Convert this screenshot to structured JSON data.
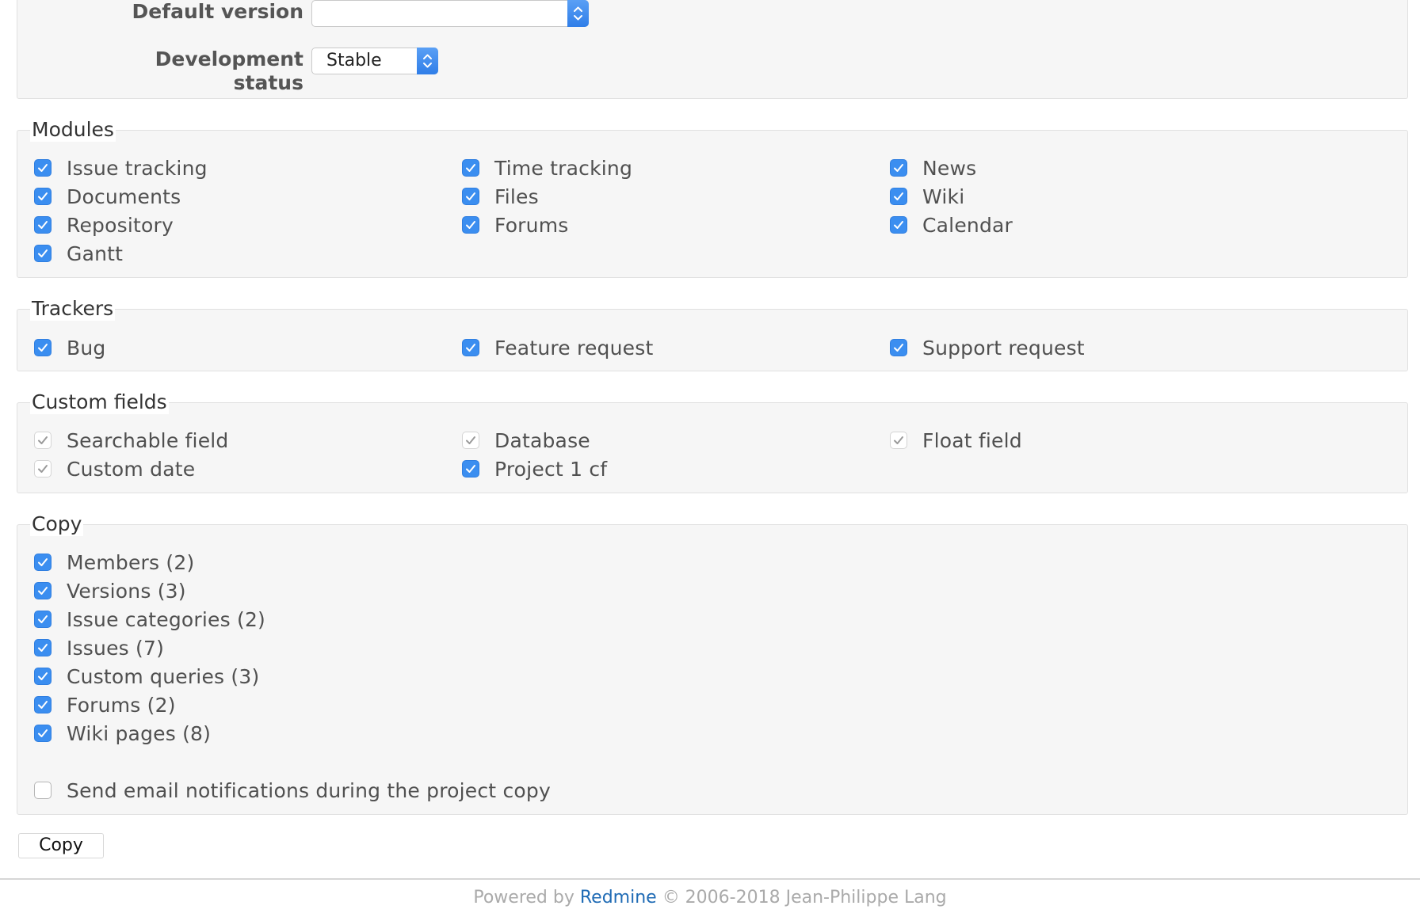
{
  "form": {
    "default_version": {
      "label": "Default version",
      "value": ""
    },
    "development_status": {
      "label": "Development status",
      "value": "Stable"
    }
  },
  "modules": {
    "legend": "Modules",
    "items": [
      {
        "label": "Issue tracking",
        "checked": true
      },
      {
        "label": "Time tracking",
        "checked": true
      },
      {
        "label": "News",
        "checked": true
      },
      {
        "label": "Documents",
        "checked": true
      },
      {
        "label": "Files",
        "checked": true
      },
      {
        "label": "Wiki",
        "checked": true
      },
      {
        "label": "Repository",
        "checked": true
      },
      {
        "label": "Forums",
        "checked": true
      },
      {
        "label": "Calendar",
        "checked": true
      },
      {
        "label": "Gantt",
        "checked": true
      }
    ]
  },
  "trackers": {
    "legend": "Trackers",
    "items": [
      {
        "label": "Bug",
        "checked": true
      },
      {
        "label": "Feature request",
        "checked": true
      },
      {
        "label": "Support request",
        "checked": true
      }
    ]
  },
  "custom_fields": {
    "legend": "Custom fields",
    "items": [
      {
        "label": "Searchable field",
        "checked": true,
        "disabled": true
      },
      {
        "label": "Database",
        "checked": true,
        "disabled": true
      },
      {
        "label": "Float field",
        "checked": true,
        "disabled": true
      },
      {
        "label": "Custom date",
        "checked": true,
        "disabled": true
      },
      {
        "label": "Project 1 cf",
        "checked": true,
        "disabled": false
      }
    ]
  },
  "copy": {
    "legend": "Copy",
    "items": [
      {
        "label": "Members (2)",
        "checked": true
      },
      {
        "label": "Versions (3)",
        "checked": true
      },
      {
        "label": "Issue categories (2)",
        "checked": true
      },
      {
        "label": "Issues (7)",
        "checked": true
      },
      {
        "label": "Custom queries (3)",
        "checked": true
      },
      {
        "label": "Forums (2)",
        "checked": true
      },
      {
        "label": "Wiki pages (8)",
        "checked": true
      }
    ],
    "notify": {
      "label": "Send email notifications during the project copy",
      "checked": false
    }
  },
  "submit_label": "Copy",
  "footer": {
    "prefix": "Powered by",
    "link": "Redmine",
    "suffix": "© 2006-2018 Jean-Philippe Lang"
  },
  "colors": {
    "checkbox_checked": "#3b8ef0",
    "link": "#1f6bb5",
    "panel_bg": "#f6f6f6"
  }
}
